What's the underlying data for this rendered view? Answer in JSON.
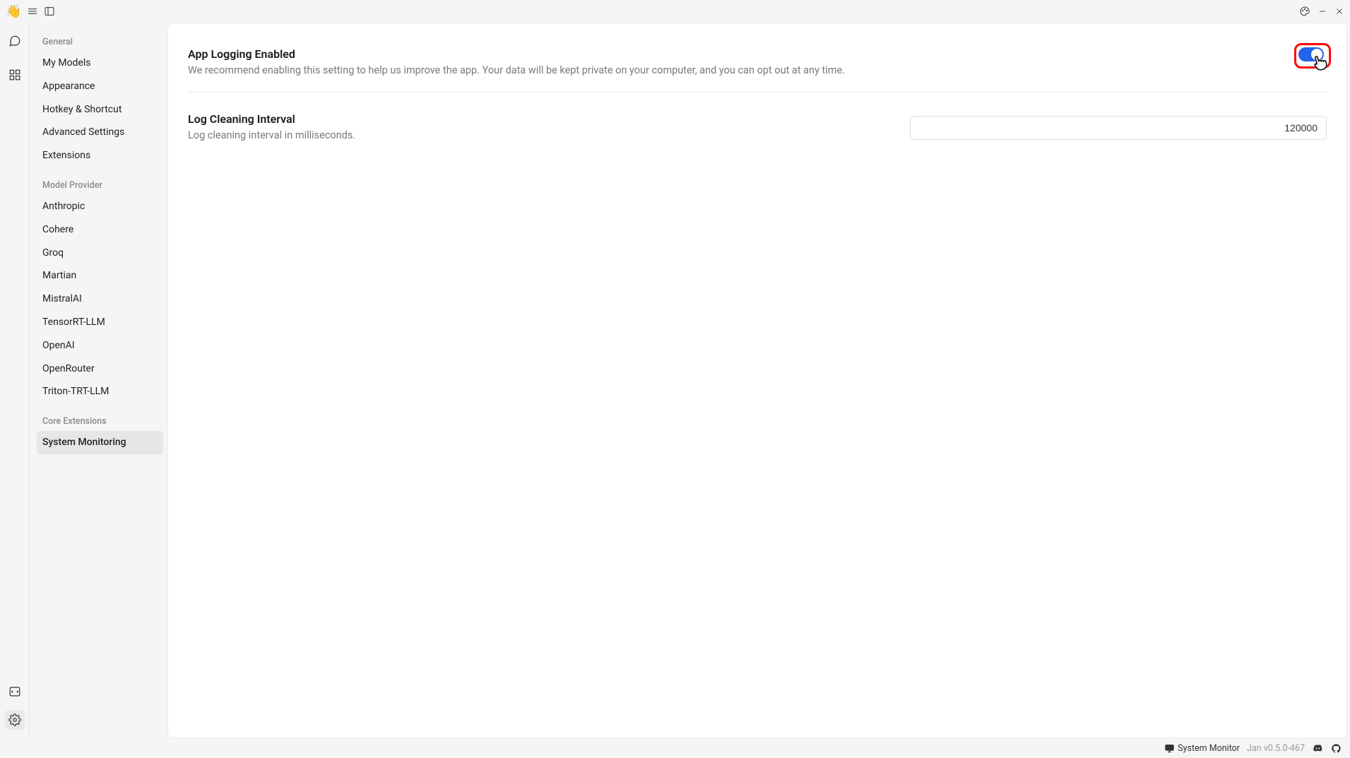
{
  "titlebar": {
    "logo": "👋"
  },
  "rail": {
    "items": [
      "chat",
      "grid",
      "code",
      "settings"
    ]
  },
  "sidebar": {
    "sections": [
      {
        "heading": "General",
        "items": [
          {
            "label": "My Models"
          },
          {
            "label": "Appearance"
          },
          {
            "label": "Hotkey & Shortcut"
          },
          {
            "label": "Advanced Settings"
          },
          {
            "label": "Extensions"
          }
        ]
      },
      {
        "heading": "Model Provider",
        "items": [
          {
            "label": "Anthropic"
          },
          {
            "label": "Cohere"
          },
          {
            "label": "Groq"
          },
          {
            "label": "Martian"
          },
          {
            "label": "MistralAI"
          },
          {
            "label": "TensorRT-LLM"
          },
          {
            "label": "OpenAI"
          },
          {
            "label": "OpenRouter"
          },
          {
            "label": "Triton-TRT-LLM"
          }
        ]
      },
      {
        "heading": "Core Extensions",
        "items": [
          {
            "label": "System Monitoring",
            "active": true
          }
        ]
      }
    ]
  },
  "settings": {
    "app_logging": {
      "title": "App Logging Enabled",
      "desc": "We recommend enabling this setting to help us improve the app. Your data will be kept private on your computer, and you can opt out at any time.",
      "value": true
    },
    "log_interval": {
      "title": "Log Cleaning Interval",
      "desc": "Log cleaning interval in milliseconds.",
      "value": "120000"
    }
  },
  "statusbar": {
    "monitor_label": "System Monitor",
    "version": "Jan v0.5.0-467"
  }
}
